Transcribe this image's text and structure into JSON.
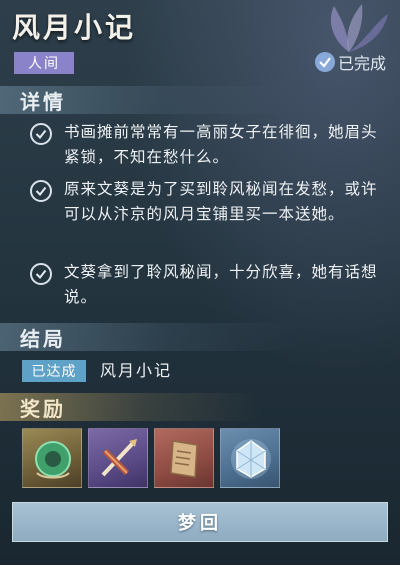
{
  "quest": {
    "title": "风月小记",
    "region": "人间",
    "status": "已完成"
  },
  "details": {
    "header": "详情",
    "tasks": [
      "书画摊前常常有一高丽女子在徘徊，她眉头紧锁，不知在愁什么。",
      "原来文葵是为了买到聆风秘闻在发愁，或许可以从汴京的风月宝铺里买一本送她。",
      "文葵拿到了聆风秘闻，十分欣喜，她有话想说。"
    ]
  },
  "ending": {
    "header": "结局",
    "badge": "已达成",
    "name": "风月小记"
  },
  "rewards": {
    "header": "奖励",
    "items": [
      {
        "icon": "jade-pendant-icon",
        "rarity_color": "#9a8a55"
      },
      {
        "icon": "quill-scroll-icon",
        "rarity_color": "#7b6aa6"
      },
      {
        "icon": "paper-book-icon",
        "rarity_color": "#b26a5e"
      },
      {
        "icon": "ice-crystal-icon",
        "rarity_color": "#6c8fae"
      }
    ]
  },
  "actions": {
    "dream_button": "梦回"
  },
  "colors": {
    "region_badge": "#8b83c9",
    "achieved_badge": "#5fa2c8",
    "status_check": "#87a8d8",
    "button": "#a8c2d4"
  }
}
